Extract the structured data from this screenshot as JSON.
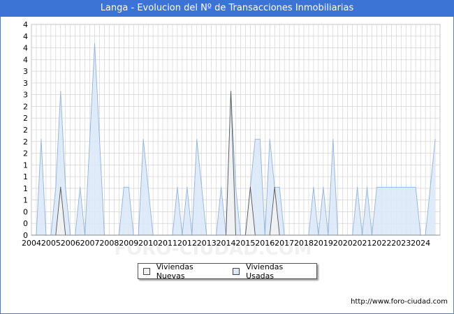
{
  "page": {
    "title": "Langa - Evolucion del Nº de Transacciones Inmobiliarias",
    "source": "http://www.foro-ciudad.com",
    "watermark": "FORO-CIUDAD.COM"
  },
  "chart_data": {
    "type": "area",
    "title": "Langa - Evolucion del Nº de Transacciones Inmobiliarias",
    "xlabel": "",
    "ylabel": "",
    "x_ticks": [
      "2004",
      "2005",
      "2006",
      "2007",
      "2008",
      "2009",
      "2010",
      "2011",
      "2012",
      "2013",
      "2014",
      "2015",
      "2016",
      "2017",
      "2018",
      "2019",
      "2020",
      "2021",
      "2022",
      "2023",
      "2024"
    ],
    "y_ticks": [
      "0",
      "0",
      "0",
      "1",
      "1",
      "1",
      "1",
      "2",
      "2",
      "2",
      "2",
      "2",
      "3",
      "3",
      "3",
      "4",
      "4",
      "4",
      "4"
    ],
    "xlim": [
      2004.0,
      2025.0
    ],
    "ylim": [
      0,
      4.4
    ],
    "grid": true,
    "legend_position": "bottom-center",
    "colors": {
      "nuevas_fill": "#f2f2f2",
      "nuevas_line": "#555555",
      "usadas_fill": "#dbe9f8",
      "usadas_line": "#8fb3e0",
      "grid": "#cccccc",
      "title_bg": "#3c74d6"
    },
    "series": [
      {
        "name": "Viviendas Nuevas",
        "points": [
          [
            2005.25,
            0
          ],
          [
            2005.5,
            1
          ],
          [
            2005.75,
            0
          ],
          [
            2014.0,
            0
          ],
          [
            2014.25,
            3
          ],
          [
            2014.5,
            0
          ],
          [
            2015.0,
            0
          ],
          [
            2015.25,
            1
          ],
          [
            2015.5,
            0
          ],
          [
            2016.25,
            0
          ],
          [
            2016.5,
            1
          ],
          [
            2016.75,
            0
          ]
        ]
      },
      {
        "name": "Viviendas Usadas",
        "points": [
          [
            2004.25,
            0
          ],
          [
            2004.5,
            2
          ],
          [
            2004.75,
            0
          ],
          [
            2005.0,
            0
          ],
          [
            2005.25,
            1
          ],
          [
            2005.5,
            3
          ],
          [
            2005.75,
            1
          ],
          [
            2006.0,
            0
          ],
          [
            2006.25,
            0
          ],
          [
            2006.5,
            1
          ],
          [
            2006.75,
            0
          ],
          [
            2006.75,
            0
          ],
          [
            2007.0,
            2
          ],
          [
            2007.25,
            4
          ],
          [
            2007.5,
            2
          ],
          [
            2007.75,
            0
          ],
          [
            2008.5,
            0
          ],
          [
            2008.75,
            1
          ],
          [
            2009.0,
            1
          ],
          [
            2009.25,
            0
          ],
          [
            2009.5,
            0
          ],
          [
            2009.75,
            2
          ],
          [
            2010.0,
            1
          ],
          [
            2010.25,
            0
          ],
          [
            2011.25,
            0
          ],
          [
            2011.5,
            1
          ],
          [
            2011.75,
            0
          ],
          [
            2011.75,
            0
          ],
          [
            2012.0,
            1
          ],
          [
            2012.25,
            0
          ],
          [
            2012.25,
            0
          ],
          [
            2012.5,
            2
          ],
          [
            2012.75,
            1
          ],
          [
            2013.0,
            0
          ],
          [
            2013.5,
            0
          ],
          [
            2013.75,
            1
          ],
          [
            2014.0,
            0
          ],
          [
            2014.0,
            0
          ],
          [
            2014.25,
            3
          ],
          [
            2014.5,
            1
          ],
          [
            2014.75,
            0
          ],
          [
            2015.0,
            0
          ],
          [
            2015.25,
            1
          ],
          [
            2015.5,
            2
          ],
          [
            2015.75,
            2
          ],
          [
            2016.0,
            0
          ],
          [
            2016.0,
            0
          ],
          [
            2016.25,
            2
          ],
          [
            2016.5,
            1
          ],
          [
            2016.75,
            1
          ],
          [
            2017.0,
            0
          ],
          [
            2018.25,
            0
          ],
          [
            2018.5,
            1
          ],
          [
            2018.75,
            0
          ],
          [
            2018.75,
            0
          ],
          [
            2019.0,
            1
          ],
          [
            2019.25,
            0
          ],
          [
            2019.25,
            0
          ],
          [
            2019.5,
            2
          ],
          [
            2019.75,
            0
          ],
          [
            2020.5,
            0
          ],
          [
            2020.75,
            1
          ],
          [
            2021.0,
            0
          ],
          [
            2021.0,
            0
          ],
          [
            2021.25,
            1
          ],
          [
            2021.5,
            0
          ],
          [
            2021.5,
            0
          ],
          [
            2021.75,
            1
          ],
          [
            2022.0,
            1
          ],
          [
            2022.25,
            1
          ],
          [
            2022.5,
            1
          ],
          [
            2022.75,
            1
          ],
          [
            2023.0,
            1
          ],
          [
            2023.25,
            1
          ],
          [
            2023.5,
            1
          ],
          [
            2023.75,
            1
          ],
          [
            2024.0,
            0
          ],
          [
            2024.25,
            0
          ],
          [
            2024.5,
            1
          ],
          [
            2024.75,
            2
          ]
        ]
      }
    ]
  }
}
